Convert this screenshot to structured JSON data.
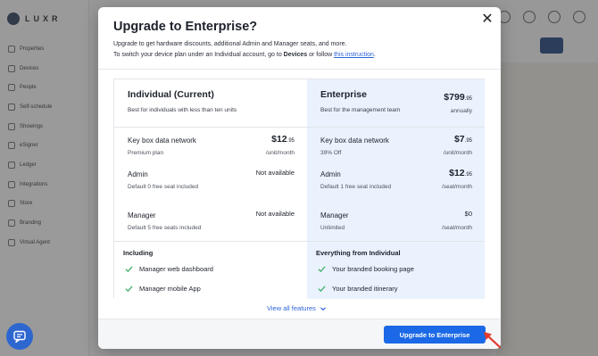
{
  "app": {
    "logo_text": "LUXR",
    "nav_items": [
      "Properties",
      "Devices",
      "People",
      "Self-schedule",
      "Showings",
      "eSigner",
      "Ledger",
      "Integrations",
      "Store",
      "Branding",
      "Virtual Agent"
    ]
  },
  "modal": {
    "title": "Upgrade to Enterprise?",
    "desc_line1": "Upgrade to get hardware discounts, additional Admin and Manager seats, and more.",
    "desc_line2_prefix": "To switch your device plan under an Individual account, go to ",
    "desc_line2_bold": "Devices",
    "desc_line2_mid": " or follow ",
    "desc_line2_link": "this instruction",
    "desc_line2_suffix": ".",
    "view_all": "View all features",
    "upgrade_button": "Upgrade to Enterprise"
  },
  "plans": {
    "individual": {
      "name": "Individual (Current)",
      "subtitle": "Best for individuals with less than ten units",
      "rows": [
        {
          "title": "Key box data network",
          "sub": "Premium plan",
          "price_main": "$12",
          "price_cents": ".95",
          "unit": "/unit/month"
        },
        {
          "title": "Admin",
          "sub": "Default 0 free seat included",
          "plain": "Not available"
        },
        {
          "title": "Manager",
          "sub": "Default 5 free seats included",
          "plain": "Not available"
        }
      ],
      "including_title": "Including",
      "features": [
        "Manager web dashboard",
        "Manager mobile App"
      ]
    },
    "enterprise": {
      "name": "Enterprise",
      "subtitle": "Best for the management team",
      "price_main": "$799",
      "price_cents": ".95",
      "billing": "annually",
      "rows": [
        {
          "title": "Key box data network",
          "sub": "39% Off",
          "price_main": "$7",
          "price_cents": ".95",
          "unit": "/unit/month"
        },
        {
          "title": "Admin",
          "sub": "Default 1 free seat included",
          "price_main": "$12",
          "price_cents": ".95",
          "unit": "/seat/month"
        },
        {
          "title": "Manager",
          "sub": "Unlimited",
          "plain": "$0",
          "unit": "/seat/month"
        }
      ],
      "including_title": "Everything from Individual",
      "features": [
        "Your branded booking page",
        "Your branded itinerary"
      ]
    }
  },
  "colors": {
    "accent": "#1b69e6",
    "check": "#3fae6b",
    "enterprise_bg": "#eaf2fd"
  }
}
